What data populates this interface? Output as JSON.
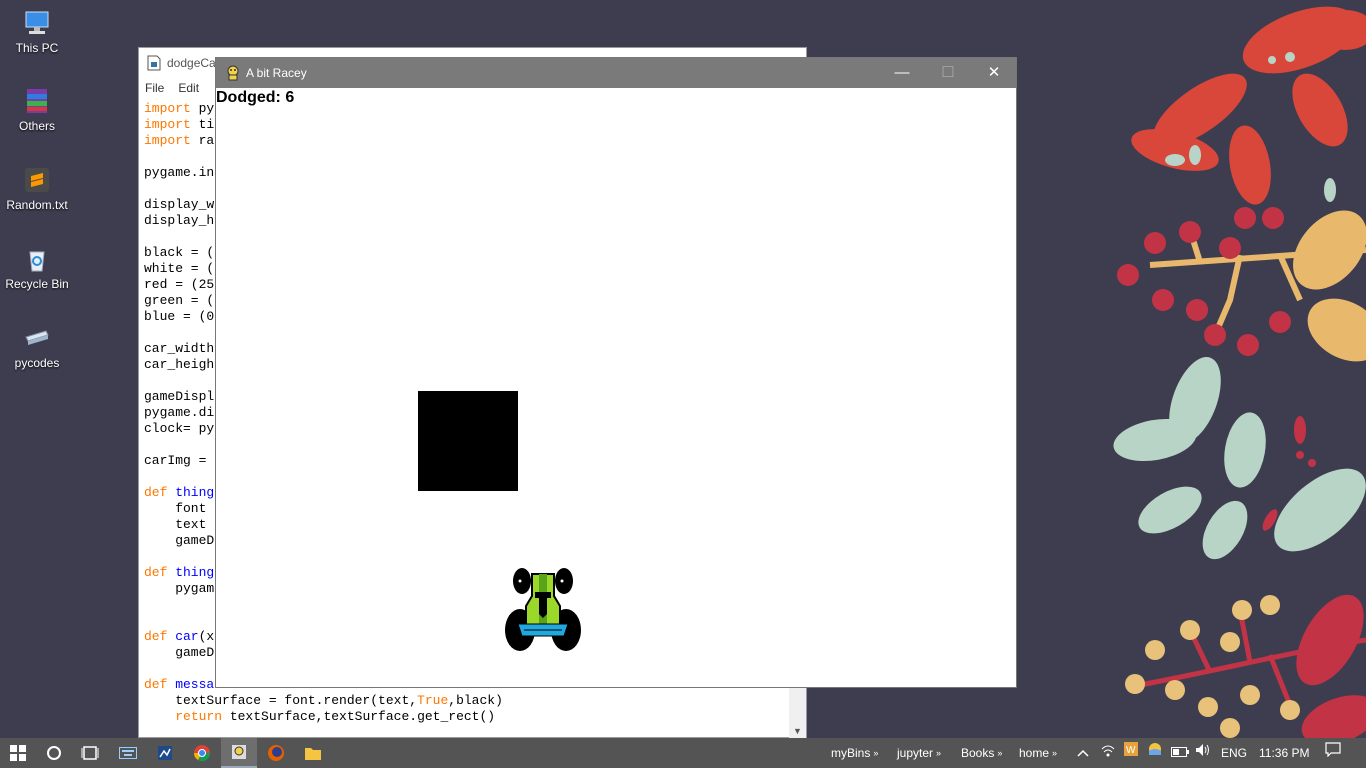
{
  "desktop": {
    "icons": [
      {
        "label": "This PC",
        "icon": "computer-icon"
      },
      {
        "label": "Others",
        "icon": "winrar-icon"
      },
      {
        "label": "Random.txt",
        "icon": "sublime-text-icon"
      },
      {
        "label": "Recycle Bin",
        "icon": "recycle-bin-icon"
      },
      {
        "label": "pycodes",
        "icon": "folder-icon"
      }
    ]
  },
  "idle_window": {
    "title": "dodgeCa",
    "menu": [
      "File",
      "Edit"
    ],
    "code_lines": [
      {
        "kw": "import",
        "rest": " py"
      },
      {
        "kw": "import",
        "rest": " ti"
      },
      {
        "kw": "import",
        "rest": " ra"
      },
      {
        "kw": "",
        "rest": ""
      },
      {
        "kw": "",
        "rest": "pygame.in"
      },
      {
        "kw": "",
        "rest": ""
      },
      {
        "kw": "",
        "rest": "display_w"
      },
      {
        "kw": "",
        "rest": "display_h"
      },
      {
        "kw": "",
        "rest": ""
      },
      {
        "kw": "",
        "rest": "black = ("
      },
      {
        "kw": "",
        "rest": "white = ("
      },
      {
        "kw": "",
        "rest": "red = (25"
      },
      {
        "kw": "",
        "rest": "green = ("
      },
      {
        "kw": "",
        "rest": "blue = (0"
      },
      {
        "kw": "",
        "rest": ""
      },
      {
        "kw": "",
        "rest": "car_width"
      },
      {
        "kw": "",
        "rest": "car_heigh"
      },
      {
        "kw": "",
        "rest": ""
      },
      {
        "kw": "",
        "rest": "gameDispl"
      },
      {
        "kw": "",
        "rest": "pygame.di"
      },
      {
        "kw": "",
        "rest": "clock= py"
      },
      {
        "kw": "",
        "rest": ""
      },
      {
        "kw": "",
        "rest": "carImg = "
      },
      {
        "kw": "",
        "rest": ""
      },
      {
        "kw": "def",
        "fn": " thing",
        "rest": ""
      },
      {
        "kw": "",
        "rest": "    font "
      },
      {
        "kw": "",
        "rest": "    text "
      },
      {
        "kw": "",
        "rest": "    gameD"
      },
      {
        "kw": "",
        "rest": ""
      },
      {
        "kw": "def",
        "fn": " thing",
        "rest": ""
      },
      {
        "kw": "",
        "rest": "    pygam"
      },
      {
        "kw": "",
        "rest": ""
      },
      {
        "kw": "",
        "rest": ""
      },
      {
        "kw": "def",
        "fn": " car",
        "rest": "(x"
      },
      {
        "kw": "",
        "rest": "    gameD"
      },
      {
        "kw": "",
        "rest": ""
      },
      {
        "kw": "def",
        "fn": " messa",
        "rest": ""
      }
    ],
    "code_tail": [
      "    textSurface = font.render(text,",
      "True",
      ",black)",
      "    ",
      "return",
      " textSurface,textSurface.get_rect()"
    ]
  },
  "game_window": {
    "title": "A bit Racey",
    "minimize": "—",
    "maximize": "☐",
    "close": "✕",
    "score_text": "Dodged: 6"
  },
  "taskbar": {
    "toolbar_items": [
      "myBins",
      "jupyter",
      "Books",
      "home"
    ],
    "language": "ENG",
    "time": "11:36 PM"
  }
}
